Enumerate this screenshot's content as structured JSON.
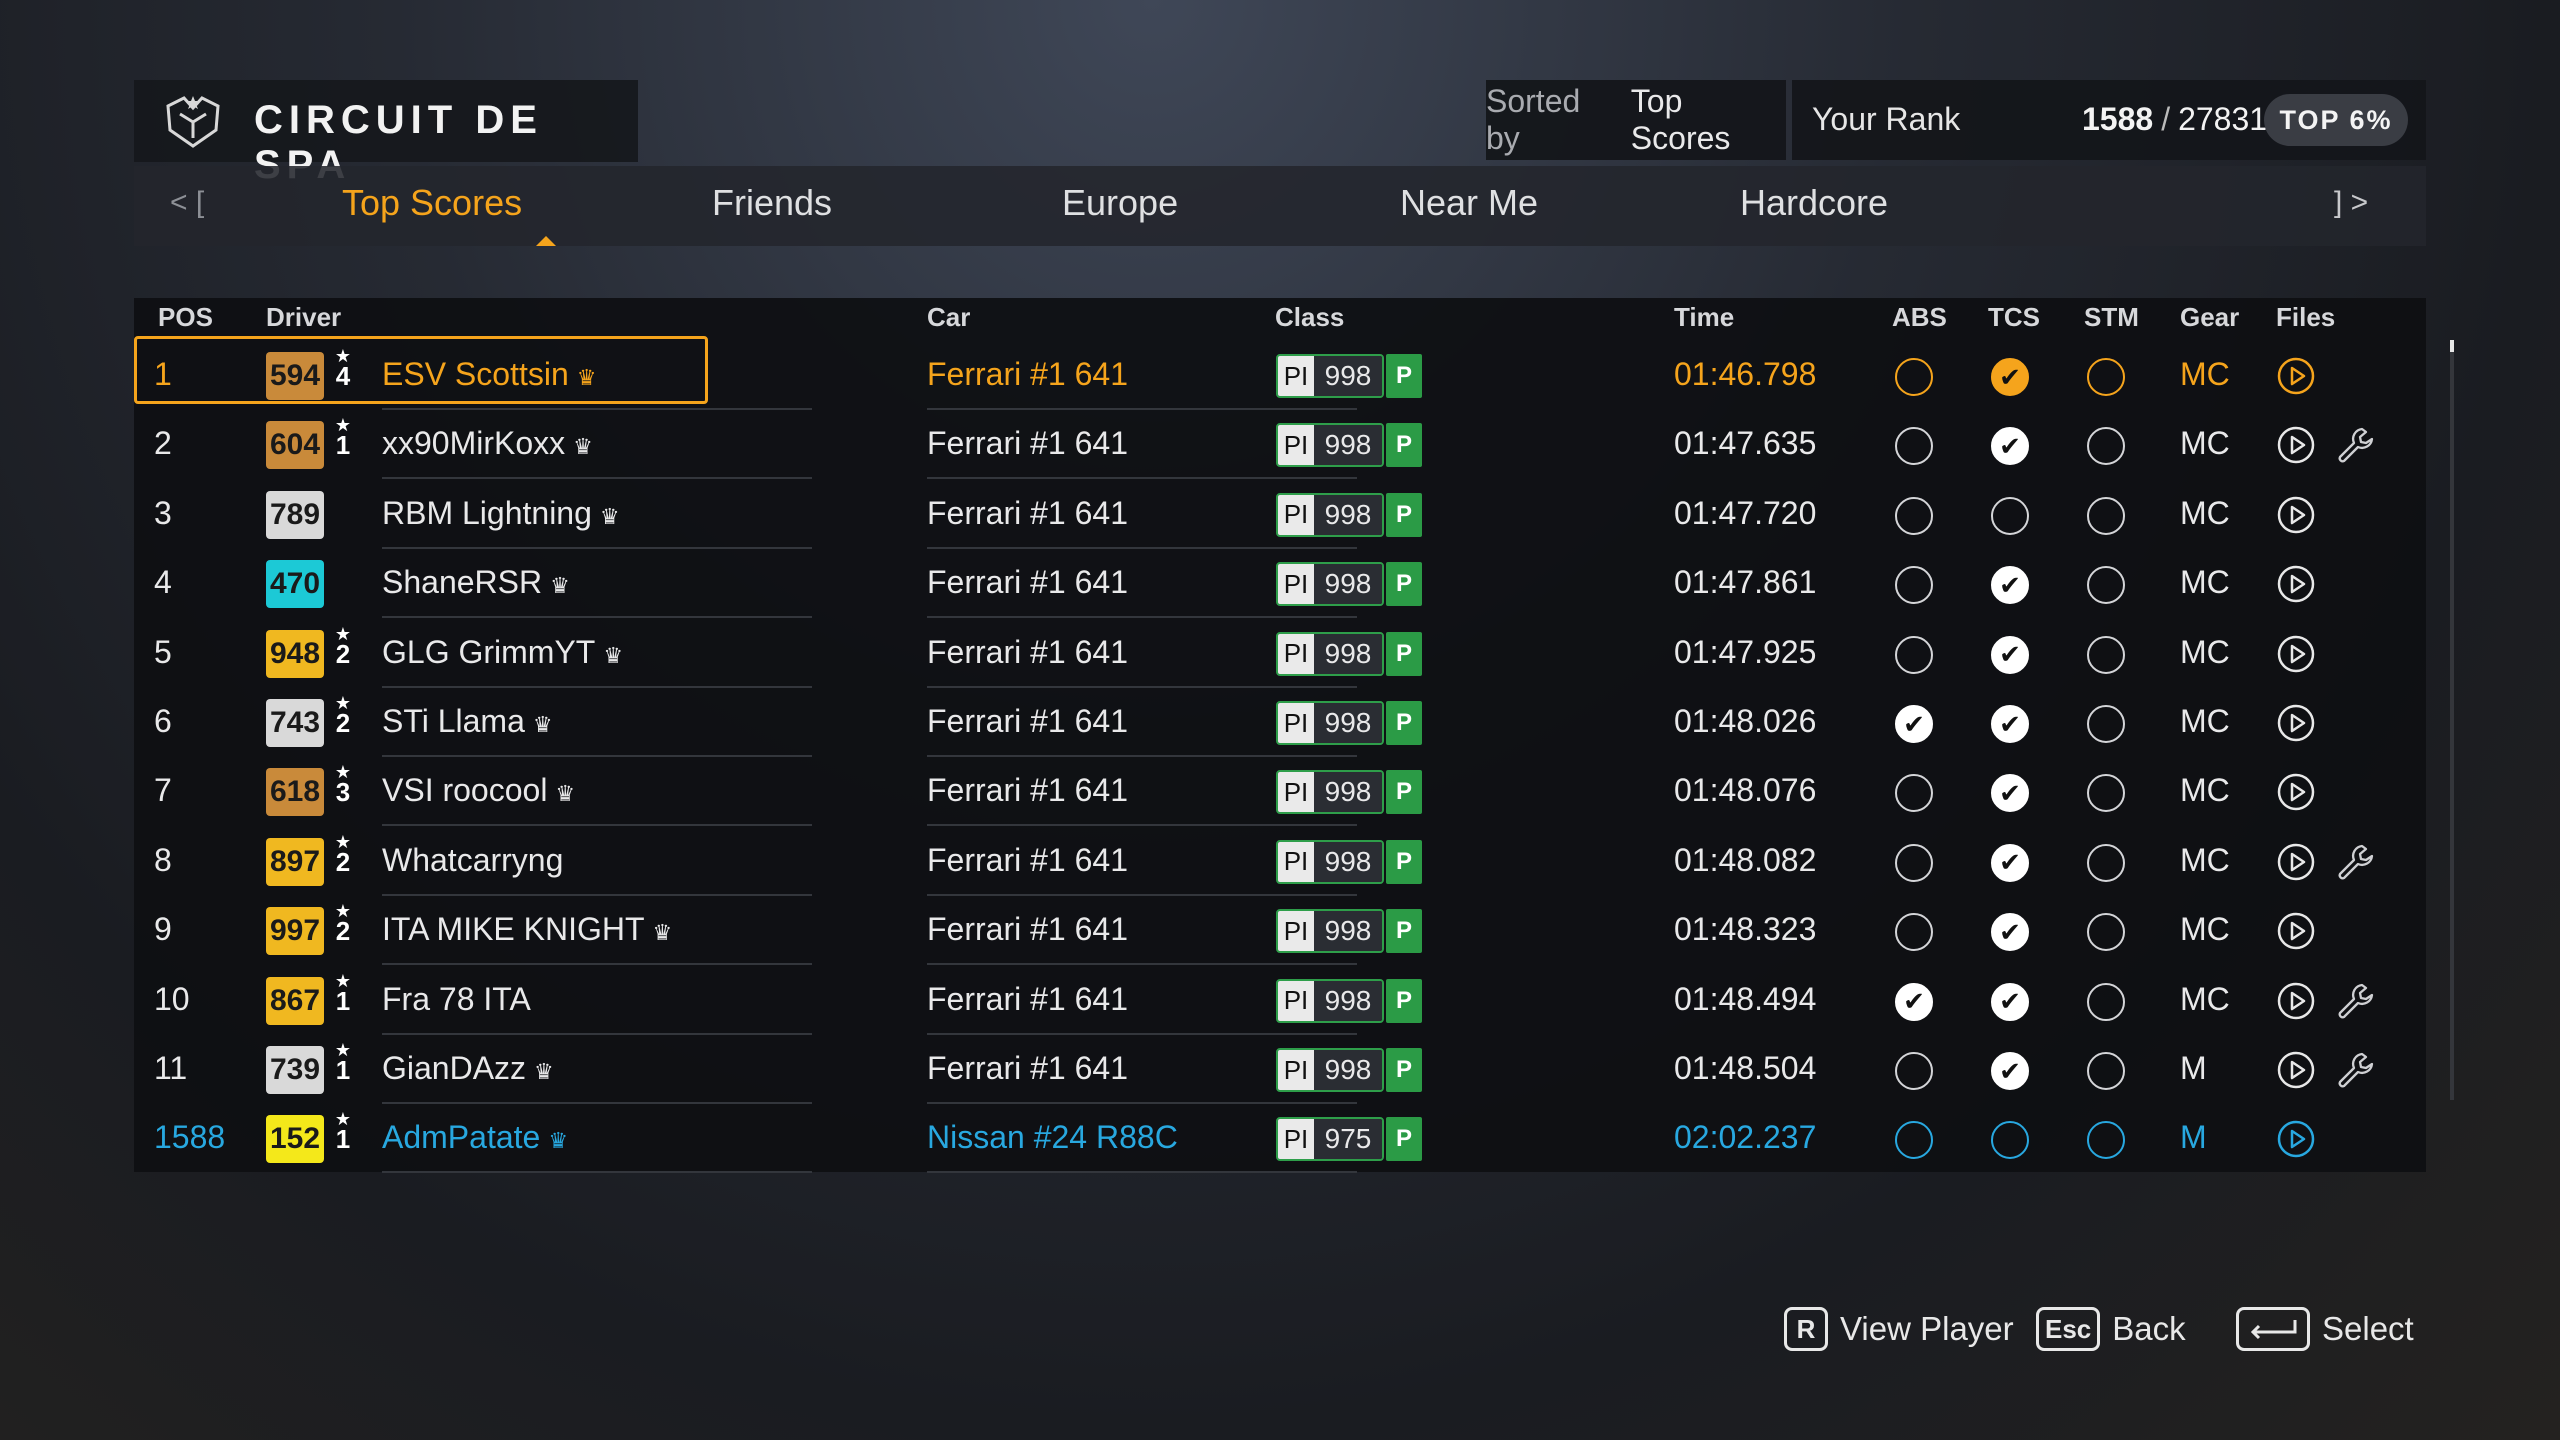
{
  "header": {
    "track_title": "CIRCUIT DE SPA",
    "sorted_label": "Sorted by",
    "sorted_value": "Top Scores",
    "rank_label": "Your Rank",
    "rank_position": "1588",
    "rank_separator": "/",
    "rank_total": "27831",
    "top_label": "TOP 6%"
  },
  "tabs": {
    "nav_left": "<  [",
    "nav_right": "]  >",
    "items": [
      {
        "label": "Top Scores",
        "active": true
      },
      {
        "label": "Friends"
      },
      {
        "label": "Europe"
      },
      {
        "label": "Near Me"
      },
      {
        "label": "Hardcore"
      }
    ]
  },
  "columns": {
    "pos": "POS",
    "driver": "Driver",
    "car": "Car",
    "class": "Class",
    "time": "Time",
    "abs": "ABS",
    "tcs": "TCS",
    "stm": "STM",
    "gear": "Gear",
    "files": "Files"
  },
  "colors": {
    "accent": "#f5a41c",
    "player": "#28a8e0",
    "class_p": "#2b9b46"
  },
  "rows": [
    {
      "pos": "1",
      "level": "594",
      "stars": "4",
      "badge": "#c98a3a",
      "driver": "ESV Scottsin",
      "crown": true,
      "car": "Ferrari #1 641",
      "pi_label": "PI",
      "pi": "998",
      "class": "P",
      "time": "01:46.798",
      "abs": false,
      "tcs": true,
      "stm": false,
      "gear": "MC",
      "wrench": false,
      "highlight": "gold"
    },
    {
      "pos": "2",
      "level": "604",
      "stars": "1",
      "badge": "#c98a3a",
      "driver": "xx90MirKoxx",
      "crown": true,
      "car": "Ferrari #1 641",
      "pi_label": "PI",
      "pi": "998",
      "class": "P",
      "time": "01:47.635",
      "abs": false,
      "tcs": true,
      "stm": false,
      "gear": "MC",
      "wrench": true
    },
    {
      "pos": "3",
      "level": "789",
      "stars": "",
      "badge": "#d9d9d9",
      "driver": "RBM Lightning",
      "crown": true,
      "car": "Ferrari #1 641",
      "pi_label": "PI",
      "pi": "998",
      "class": "P",
      "time": "01:47.720",
      "abs": false,
      "tcs": false,
      "stm": false,
      "gear": "MC",
      "wrench": false
    },
    {
      "pos": "4",
      "level": "470",
      "stars": "",
      "badge": "#1cc9d6",
      "driver": "ShaneRSR",
      "crown": true,
      "car": "Ferrari #1 641",
      "pi_label": "PI",
      "pi": "998",
      "class": "P",
      "time": "01:47.861",
      "abs": false,
      "tcs": true,
      "stm": false,
      "gear": "MC",
      "wrench": false
    },
    {
      "pos": "5",
      "level": "948",
      "stars": "2",
      "badge": "#f0b820",
      "driver": "GLG GrimmYT",
      "crown": true,
      "car": "Ferrari #1 641",
      "pi_label": "PI",
      "pi": "998",
      "class": "P",
      "time": "01:47.925",
      "abs": false,
      "tcs": true,
      "stm": false,
      "gear": "MC",
      "wrench": false
    },
    {
      "pos": "6",
      "level": "743",
      "stars": "2",
      "badge": "#d9d9d9",
      "driver": "STi Llama",
      "crown": true,
      "car": "Ferrari #1 641",
      "pi_label": "PI",
      "pi": "998",
      "class": "P",
      "time": "01:48.026",
      "abs": true,
      "tcs": true,
      "stm": false,
      "gear": "MC",
      "wrench": false
    },
    {
      "pos": "7",
      "level": "618",
      "stars": "3",
      "badge": "#c98a3a",
      "driver": "VSI roocool",
      "crown": true,
      "car": "Ferrari #1 641",
      "pi_label": "PI",
      "pi": "998",
      "class": "P",
      "time": "01:48.076",
      "abs": false,
      "tcs": true,
      "stm": false,
      "gear": "MC",
      "wrench": false
    },
    {
      "pos": "8",
      "level": "897",
      "stars": "2",
      "badge": "#f0b820",
      "driver": "Whatcarryng",
      "crown": false,
      "car": "Ferrari #1 641",
      "pi_label": "PI",
      "pi": "998",
      "class": "P",
      "time": "01:48.082",
      "abs": false,
      "tcs": true,
      "stm": false,
      "gear": "MC",
      "wrench": true
    },
    {
      "pos": "9",
      "level": "997",
      "stars": "2",
      "badge": "#f0b820",
      "driver": "ITA MIKE KNIGHT",
      "crown": true,
      "car": "Ferrari #1 641",
      "pi_label": "PI",
      "pi": "998",
      "class": "P",
      "time": "01:48.323",
      "abs": false,
      "tcs": true,
      "stm": false,
      "gear": "MC",
      "wrench": false
    },
    {
      "pos": "10",
      "level": "867",
      "stars": "1",
      "badge": "#f0b820",
      "driver": "Fra 78 ITA",
      "crown": false,
      "car": "Ferrari #1 641",
      "pi_label": "PI",
      "pi": "998",
      "class": "P",
      "time": "01:48.494",
      "abs": true,
      "tcs": true,
      "stm": false,
      "gear": "MC",
      "wrench": true
    },
    {
      "pos": "11",
      "level": "739",
      "stars": "1",
      "badge": "#d9d9d9",
      "driver": "GianDAzz",
      "crown": true,
      "car": "Ferrari #1 641",
      "pi_label": "PI",
      "pi": "998",
      "class": "P",
      "time": "01:48.504",
      "abs": false,
      "tcs": true,
      "stm": false,
      "gear": "M",
      "wrench": true
    },
    {
      "pos": "1588",
      "level": "152",
      "stars": "1",
      "badge": "#f4e81a",
      "driver": "AdmPatate",
      "crown": true,
      "car": "Nissan #24 R88C",
      "pi_label": "PI",
      "pi": "975",
      "class": "P",
      "time": "02:02.237",
      "abs": false,
      "tcs": false,
      "stm": false,
      "gear": "M",
      "wrench": false,
      "player": true
    }
  ],
  "footer": {
    "view_player_key": "R",
    "view_player": "View Player",
    "back_key": "Esc",
    "back": "Back",
    "select": "Select"
  }
}
